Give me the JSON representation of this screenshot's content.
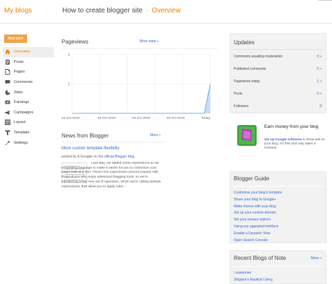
{
  "header": {
    "brand": "My blogs",
    "blog_title": "How to create blogger site",
    "separator": "·",
    "section": "Overview"
  },
  "sidebar": {
    "new_post_label": "New post",
    "items": [
      {
        "label": "Overview",
        "icon": "home-icon",
        "active": true
      },
      {
        "label": "Posts",
        "icon": "posts-icon"
      },
      {
        "label": "Pages",
        "icon": "pages-icon"
      },
      {
        "label": "Comments",
        "icon": "comments-icon"
      },
      {
        "label": "Stats",
        "icon": "stats-pie-icon"
      },
      {
        "label": "Earnings",
        "icon": "earnings-icon"
      },
      {
        "label": "Campaigns",
        "icon": "campaigns-icon"
      },
      {
        "label": "Layout",
        "icon": "layout-icon"
      },
      {
        "label": "Template",
        "icon": "template-icon"
      },
      {
        "label": "Settings",
        "icon": "wrench-icon"
      }
    ]
  },
  "pageviews": {
    "title": "Pageviews",
    "more_label": "More stats »"
  },
  "chart_data": {
    "type": "area",
    "title": "",
    "xlabel": "",
    "ylabel": "",
    "x_ticks": [
      "24 Oct 2016",
      "28 Oct 2016",
      "28 Oct 2016",
      "30 Oct 2016",
      "Today"
    ],
    "y_ticks": [
      "1",
      "2"
    ],
    "ylim": [
      0,
      2
    ],
    "grid": true,
    "series": [
      {
        "values": [
          0,
          0,
          0,
          0,
          0,
          0,
          0,
          0,
          0,
          0,
          0,
          0,
          0,
          0,
          0,
          0,
          0,
          0,
          0,
          0,
          0,
          0,
          0,
          1
        ]
      }
    ],
    "colors": {
      "fill": "#c6dbf5",
      "line": "#5b9bd5",
      "grid": "#e6e6e6"
    }
  },
  "news": {
    "title": "News from Blogger",
    "more_label": "More »",
    "post_title": "More custom template flexibility",
    "byline_prefix": "posted by A Googler on the",
    "byline_link": "official Blogger blog",
    "body": "Last May, we added some expressions to our templating language to make it easier for you to customize your blog's look and feel. These new expressions proved popular with those of you who enjoy advanced blogging tools, so we're introducing a few new set of operators, which we're calling lambda expressions, that allow you to apply rules ..."
  },
  "updates": {
    "title": "Updates",
    "rows": [
      {
        "label": "Comments awaiting moderation",
        "value": "0 »"
      },
      {
        "label": "Published comments",
        "value": "0 »"
      },
      {
        "label": "Pageviews today",
        "value": "1 »"
      },
      {
        "label": "Posts",
        "value": "0 »"
      },
      {
        "label": "Followers",
        "value": "0"
      }
    ]
  },
  "promo": {
    "title": "Earn money from your blog",
    "link_label": "Set up Google AdSense",
    "text": "to show ads on your blog. It's free and only takes a moment."
  },
  "guide": {
    "title": "Blogger Guide",
    "links": [
      "Customise your blog's template",
      "Share your blog to Google+",
      "Make money with your blog",
      "Set up your custom domain",
      "Set your privacy options",
      "Using our upgraded interface",
      "Enable a Dynamic View",
      "Open Search Console"
    ]
  },
  "recent": {
    "title": "Recent Blogs of Note",
    "more_label": "More »",
    "links": [
      "i suwannee",
      "Skipjack's Nautical Living"
    ]
  },
  "colors": {
    "accent": "#f57d00",
    "link": "#3366cc",
    "new_post": "#f6a141",
    "panel_bg": "#f2f2f2"
  }
}
